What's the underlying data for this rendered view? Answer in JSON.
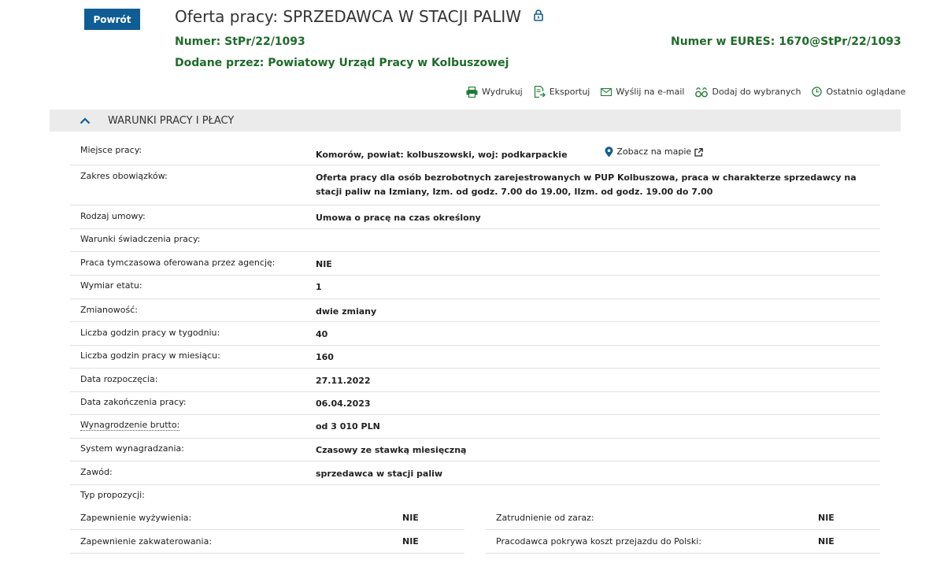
{
  "header": {
    "back_label": "Powrót",
    "title": "Oferta pracy: SPRZEDAWCA W STACJI PALIW",
    "number_label": "Numer:",
    "number_value": "StPr/22/1093",
    "eures_label": "Numer w EURES:",
    "eures_value": "1670@StPr/22/1093",
    "added_label": "Dodane przez:",
    "added_value": "Powiatowy Urząd Pracy w Kolbuszowej"
  },
  "toolbar": {
    "print": "Wydrukuj",
    "export": "Eksportuj",
    "email": "Wyślij na e-mail",
    "favorite": "Dodaj do wybranych",
    "recent": "Ostatnio oglądane"
  },
  "section": {
    "title": "WARUNKI PRACY I PŁACY"
  },
  "rows": [
    {
      "label": "Miejsce pracy:",
      "value": "Komorów, powiat: kolbuszowski, woj: podkarpackie",
      "link": "Zobacz na mapie"
    },
    {
      "label": "Zakres obowiązków:",
      "value": "Oferta pracy dla osób bezrobotnych zarejestrowanych w PUP Kolbuszowa, praca w charakterze sprzedawcy na stacji paliw na Izmiany, Izm. od godz. 7.00 do 19.00, IIzm. od godz. 19.00 do 7.00"
    },
    {
      "label": "Rodzaj umowy:",
      "value": "Umowa o pracę na czas określony"
    },
    {
      "label": "Warunki świadczenia pracy:",
      "value": ""
    },
    {
      "label": "Praca tymczasowa oferowana przez agencję:",
      "value": "NIE"
    },
    {
      "label": "Wymiar etatu:",
      "value": "1"
    },
    {
      "label": "Zmianowość:",
      "value": "dwie zmiany"
    },
    {
      "label": "Liczba godzin pracy w tygodniu:",
      "value": "40"
    },
    {
      "label": "Liczba godzin pracy w miesiącu:",
      "value": "160"
    },
    {
      "label": "Data rozpoczęcia:",
      "value": "27.11.2022"
    },
    {
      "label": "Data zakończenia pracy:",
      "value": "06.04.2023"
    },
    {
      "label": "Wynagrodzenie brutto:",
      "value": "od 3 010 PLN"
    },
    {
      "label": "System wynagradzania:",
      "value": "Czasowy ze stawką miesięczną"
    },
    {
      "label": "Zawód:",
      "value": "sprzedawca w stacji paliw"
    },
    {
      "label": "Typ propozycji:",
      "value": ""
    }
  ],
  "proposals": [
    {
      "label": "Zapewnienie wyżywienia:",
      "value": "NIE"
    },
    {
      "label": "Zatrudnienie od zaraz:",
      "value": "NIE"
    },
    {
      "label": "Zapewnienie zakwaterowania:",
      "value": "NIE"
    },
    {
      "label": "Pracodawca pokrywa koszt przejazdu do Polski:",
      "value": "NIE"
    }
  ],
  "colors": {
    "primary": "#0f5d94",
    "green": "#1e6b2a",
    "header_bg": "#ebebeb"
  },
  "icons": [
    "lock-icon",
    "print-icon",
    "export-icon",
    "mail-icon",
    "favorite-icon",
    "clock-icon",
    "chevron-up-icon",
    "map-pin-icon",
    "external-link-icon"
  ]
}
